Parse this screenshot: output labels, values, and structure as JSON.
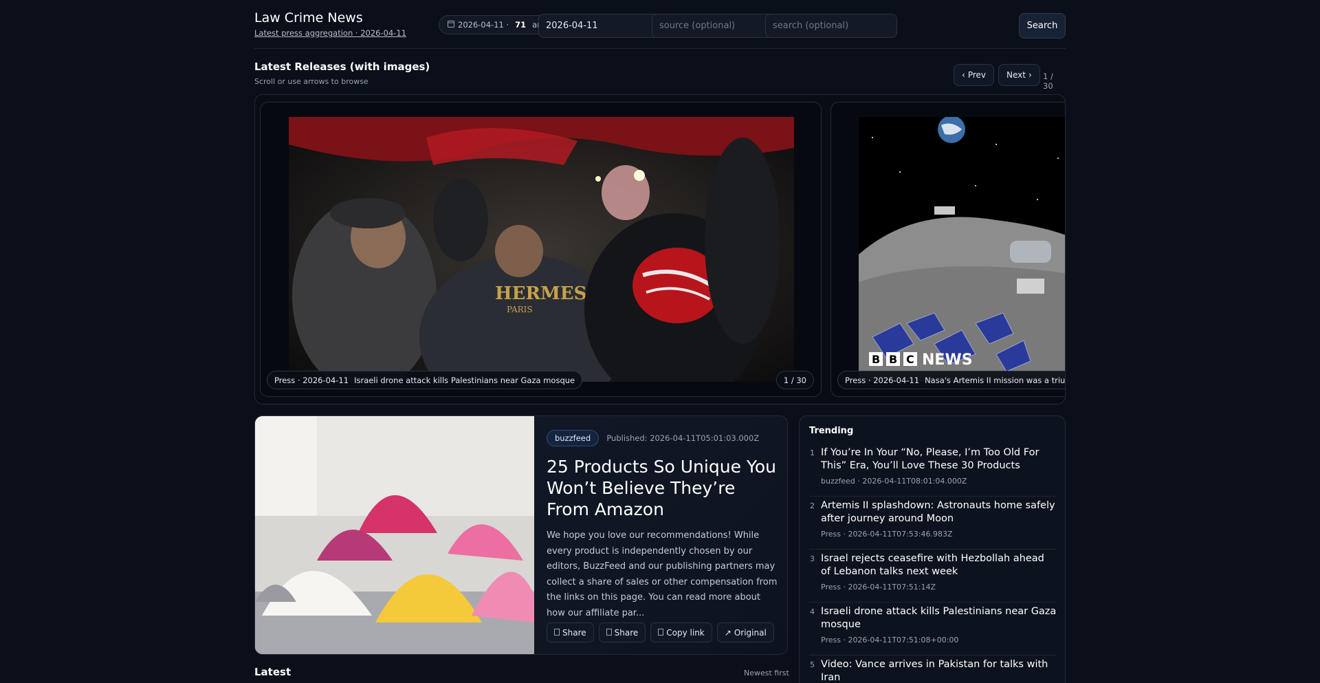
{
  "header": {
    "title": "Law Crime News",
    "subtitle": "Latest press aggregation · 2026-04-11",
    "count_icon": "calendar-icon",
    "count_date": "2026-04-11 ·",
    "count_num": "71",
    "count_label": "articles",
    "date_value": "2026-04-11",
    "source_placeholder": "source (optional)",
    "search_placeholder": "search (optional)",
    "search_label": "Search"
  },
  "carousel": {
    "title": "Latest Releases (with images)",
    "subtitle": "Scroll or use arrows to browse",
    "prev_label": "Prev",
    "next_label": "Next",
    "pager": "1 / 30",
    "slides": [
      {
        "meta": "Press · 2026-04-11",
        "title": "Israeli drone attack kills Palestinians near Gaza mosque",
        "counter": "1 / 30"
      },
      {
        "meta": "Press · 2026-04-11",
        "title": "Nasa's Artemis II mission was a triumph",
        "logo": "BBC NEWS"
      }
    ]
  },
  "featured": {
    "source": "buzzfeed",
    "published": "Published: 2026-04-11T05:01:03.000Z",
    "title": "25 Products So Unique You Won’t Believe They’re From Amazon",
    "description": "We hope you love our recommendations! While every product is independently chosen by our editors, BuzzFeed and our publishing partners may collect a share of sales or other compensation from the links on this page. You can read more about how our affiliate par...",
    "actions": [
      "Share",
      "Share",
      "Copy link",
      "Original"
    ]
  },
  "trending": {
    "title": "Trending",
    "items": [
      {
        "rank": "1",
        "title": "If You’re In Your “No, Please, I’m Too Old For This” Era, You’ll Love These 30 Products",
        "meta": "buzzfeed · 2026-04-11T08:01:04.000Z"
      },
      {
        "rank": "2",
        "title": "Artemis II splashdown: Astronauts home safely after journey around Moon",
        "meta": "Press · 2026-04-11T07:53:46.983Z"
      },
      {
        "rank": "3",
        "title": "Israel rejects ceasefire with Hezbollah ahead of Lebanon talks next week",
        "meta": "Press · 2026-04-11T07:51:14Z"
      },
      {
        "rank": "4",
        "title": "Israeli drone attack kills Palestinians near Gaza mosque",
        "meta": "Press · 2026-04-11T07:51:08+00:00"
      },
      {
        "rank": "5",
        "title": "Video: Vance arrives in Pakistan for talks with Iran",
        "meta": ""
      }
    ]
  },
  "latest": {
    "title": "Latest",
    "sort": "Newest first"
  },
  "colors": {
    "background": "#0a0f1a",
    "panel": "#0d131e",
    "border": "#222b38",
    "badge": "#14243d"
  }
}
